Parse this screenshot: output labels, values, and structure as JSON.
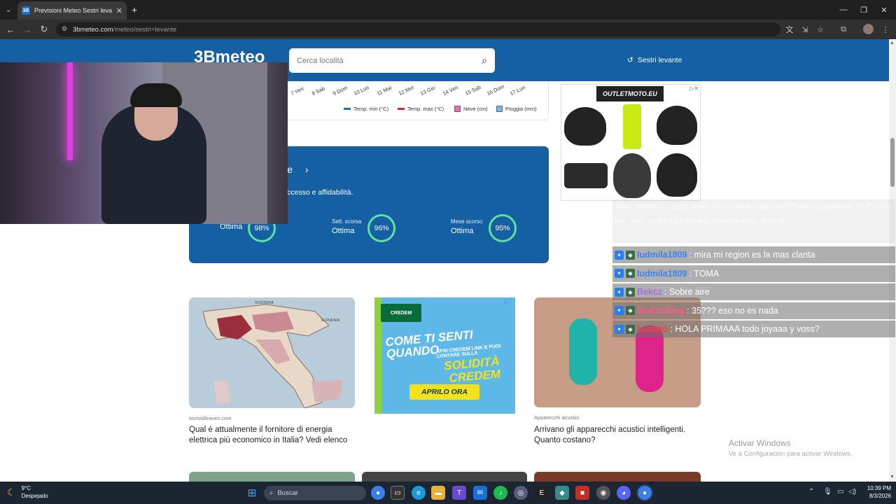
{
  "browser": {
    "tab_title": "Previsioni Meteo Sestri levante |",
    "tab_favicon": "3B",
    "url_host": "3bmeteo.com",
    "url_path": "/meteo/sestri+levante"
  },
  "site": {
    "logo_text": "3Bmeteo",
    "search_placeholder": "Cerca località",
    "location_link": "Sestri levante"
  },
  "chart_fragment": {
    "x_ticks": [
      "7 Ven",
      "8 Sab",
      "9 Dom",
      "10 Lun",
      "11 Mar",
      "12 Mer",
      "13 Gio",
      "14 Ven",
      "15 Sab",
      "16 Dom",
      "17 Lun"
    ],
    "legend": [
      {
        "label": "Temp. min (°C)",
        "color": "#1a6fb5"
      },
      {
        "label": "Temp. max (°C)",
        "color": "#d8232a"
      },
      {
        "label": "Neve (cm)",
        "color": "#e76fb0"
      },
      {
        "label": "Pioggia (mm)",
        "color": "#7fb6e8"
      }
    ]
  },
  "reliability": {
    "title_fragment": "ile",
    "subtitle_fragment": "ccesso e affidabilità.",
    "stats": [
      {
        "label": "",
        "rating": "Ottima",
        "percent": "98%",
        "value": 98
      },
      {
        "label": "Sett. scorsa",
        "rating": "Ottima",
        "percent": "96%",
        "value": 96
      },
      {
        "label": "Mese scorso",
        "rating": "Ottima",
        "percent": "95%",
        "value": 95
      }
    ]
  },
  "ad_top": {
    "brand": "OUTLETMOTO.EU"
  },
  "articles": [
    {
      "source": "itsvividleaves.com",
      "title": "Qual è attualmente il fornitore di energia elettrica più economico in Italia? Vedi elenco"
    },
    {
      "source": "",
      "title": ""
    },
    {
      "source": "Apparecchi acustici",
      "title": "Arrivano gli apparecchi acustici intelligenti. Quanto costano?"
    }
  ],
  "credem_ad": {
    "brand": "CREDEM",
    "line1": "COME TI SENTI",
    "line2": "QUANDO",
    "small": "APRI CREDEM LINK E PUOI CONTARE SULLA",
    "line3": "SOLIDITÀ",
    "line4": "CREDEM",
    "cta": "APRILO ORA"
  },
  "map_labels": [
    "SVIZZERA",
    "SLOVENIA"
  ],
  "chat": {
    "faded_text": "Alan_goncarzo : Ayyy sevilli llanos estar olfopi hold?? eso lo quisieras ?? 45.20-0 lelit, mas se llevinas paso el quisiera es lo llevaría",
    "messages": [
      {
        "user": "ludmila1809",
        "text": ": mira mi region es la mas clarita",
        "color": "#3b82f6"
      },
      {
        "user": "ludmila1809",
        "text": ": TOMA",
        "color": "#3b82f6"
      },
      {
        "user": "Bekcz",
        "text": ": Sobre aire",
        "color": "#b06ae0"
      },
      {
        "user": "RoiCrafting",
        "text": ": 35??? eso no es nada",
        "color": "#ff5a8a"
      },
      {
        "user": "Lucano",
        "text": ": HOLA PRIMAAA todo joyaaa y voss?",
        "color": "#ff3d3d"
      }
    ]
  },
  "watermark": {
    "line1": "Activar Windows",
    "line2": "Ve a Configuración para activar Windows."
  },
  "taskbar": {
    "weather_temp": "9°C",
    "weather_desc": "Despejado",
    "search_label": "Buscar",
    "time": "10:39 PM",
    "date": "8/3/2026"
  }
}
